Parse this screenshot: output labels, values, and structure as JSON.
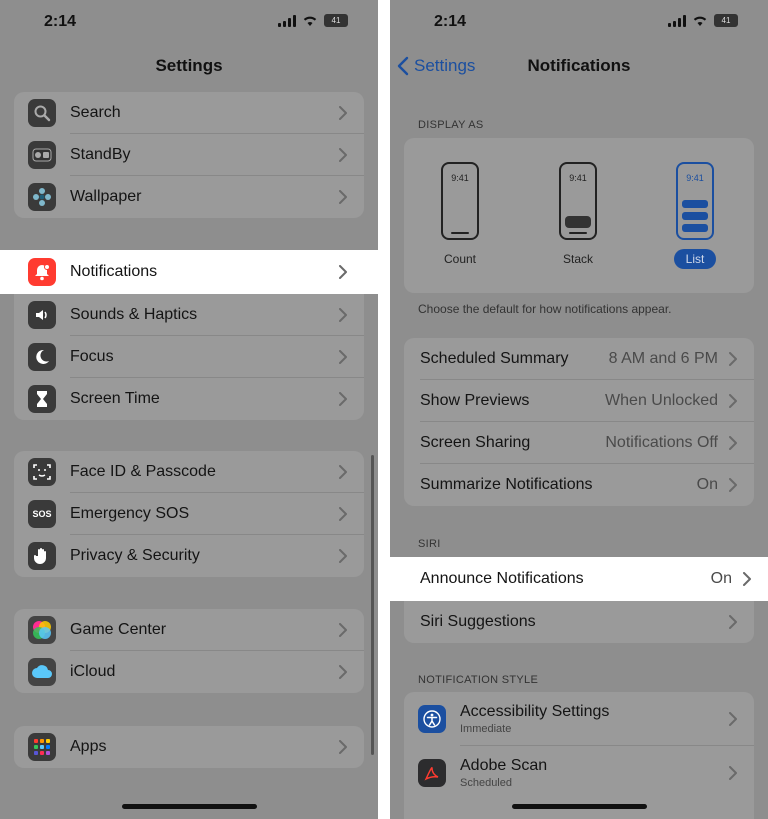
{
  "left": {
    "status": {
      "time": "2:14",
      "battery": "41"
    },
    "title": "Settings",
    "groups": [
      [
        {
          "label": "Search",
          "icon": "search-icon",
          "color": "#1c1c1e"
        },
        {
          "label": "StandBy",
          "icon": "standby-icon",
          "color": "#1c1c1e"
        },
        {
          "label": "Wallpaper",
          "icon": "wallpaper-icon",
          "color": "#1f5f7a"
        }
      ],
      [
        {
          "label": "Notifications",
          "icon": "notifications-icon",
          "color": "#ff3b30"
        },
        {
          "label": "Sounds & Haptics",
          "icon": "sounds-icon",
          "color": "#ff2d55"
        },
        {
          "label": "Focus",
          "icon": "focus-icon",
          "color": "#5e5ce6"
        },
        {
          "label": "Screen Time",
          "icon": "screen-time-icon",
          "color": "#5856d6"
        }
      ],
      [
        {
          "label": "Face ID & Passcode",
          "icon": "face-id-icon",
          "color": "#34c759"
        },
        {
          "label": "Emergency SOS",
          "icon": "sos-icon",
          "color": "#ff3b30"
        },
        {
          "label": "Privacy & Security",
          "icon": "hand-icon",
          "color": "#007aff"
        }
      ],
      [
        {
          "label": "Game Center",
          "icon": "game-center-icon",
          "color": "#ffffff"
        },
        {
          "label": "iCloud",
          "icon": "icloud-icon",
          "color": "#ffffff"
        }
      ],
      [
        {
          "label": "Apps",
          "icon": "apps-icon",
          "color": "#5856d6"
        }
      ]
    ]
  },
  "right": {
    "status": {
      "time": "2:14",
      "battery": "41"
    },
    "back_label": "Settings",
    "title": "Notifications",
    "display_as_header": "DISPLAY AS",
    "display_options": [
      {
        "label": "Count",
        "time": "9:41"
      },
      {
        "label": "Stack",
        "time": "9:41"
      },
      {
        "label": "List",
        "time": "9:41"
      }
    ],
    "display_footnote": "Choose the default for how notifications appear.",
    "settings": [
      {
        "label": "Scheduled Summary",
        "value": "8 AM and 6 PM"
      },
      {
        "label": "Show Previews",
        "value": "When Unlocked"
      },
      {
        "label": "Screen Sharing",
        "value": "Notifications Off"
      },
      {
        "label": "Summarize Notifications",
        "value": "On"
      }
    ],
    "siri_header": "SIRI",
    "siri": [
      {
        "label": "Announce Notifications",
        "value": "On"
      },
      {
        "label": "Siri Suggestions",
        "value": ""
      }
    ],
    "style_header": "NOTIFICATION STYLE",
    "apps": [
      {
        "label": "Accessibility Settings",
        "sub": "Immediate",
        "icon": "accessibility-icon",
        "color": "#007aff"
      },
      {
        "label": "Adobe Scan",
        "sub": "Scheduled",
        "icon": "adobe-scan-icon",
        "color": "#1c1c1e"
      }
    ]
  },
  "colors": {
    "accent": "#1b4fa0",
    "dim": "#8e8e8e",
    "highlight": "#ffffff"
  }
}
